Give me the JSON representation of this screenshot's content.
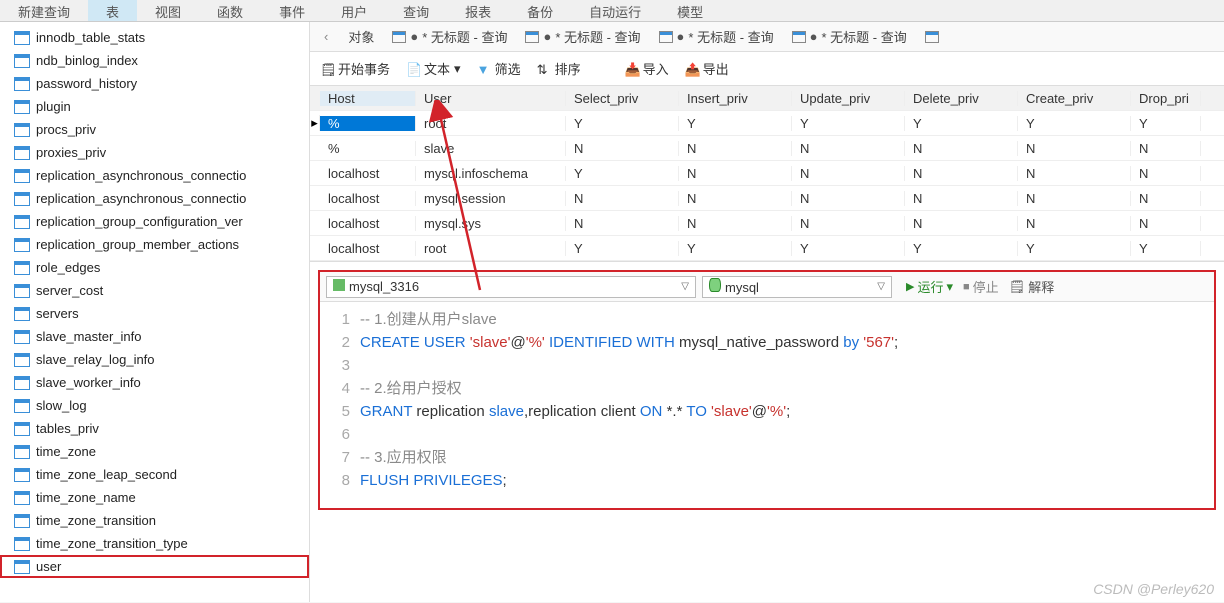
{
  "topmenu": {
    "items": [
      "新建查询",
      "表",
      "视图",
      "函数",
      "事件",
      "用户",
      "查询",
      "报表",
      "备份",
      "自动运行",
      "模型"
    ],
    "active_index": 1
  },
  "sidebar": {
    "items": [
      "innodb_table_stats",
      "ndb_binlog_index",
      "password_history",
      "plugin",
      "procs_priv",
      "proxies_priv",
      "replication_asynchronous_connectio",
      "replication_asynchronous_connectio",
      "replication_group_configuration_ver",
      "replication_group_member_actions",
      "role_edges",
      "server_cost",
      "servers",
      "slave_master_info",
      "slave_relay_log_info",
      "slave_worker_info",
      "slow_log",
      "tables_priv",
      "time_zone",
      "time_zone_leap_second",
      "time_zone_name",
      "time_zone_transition",
      "time_zone_transition_type",
      "user"
    ],
    "selected_index": 23
  },
  "tabs": {
    "object_label": "对象",
    "items": [
      {
        "dot": "●",
        "label": "* 无标题 - 查询"
      },
      {
        "dot": "●",
        "label": "* 无标题 - 查询"
      },
      {
        "dot": "●",
        "label": "* 无标题 - 查询"
      },
      {
        "dot": "●",
        "label": "* 无标题 - 查询"
      }
    ]
  },
  "toolbar": {
    "begin_tx": "开始事务",
    "text": "文本",
    "filter": "筛选",
    "sort": "排序",
    "import": "导入",
    "export": "导出"
  },
  "grid": {
    "columns": [
      "Host",
      "User",
      "Select_priv",
      "Insert_priv",
      "Update_priv",
      "Delete_priv",
      "Create_priv",
      "Drop_pri"
    ],
    "rows": [
      {
        "marker": "▸",
        "cells": [
          "%",
          "root",
          "Y",
          "Y",
          "Y",
          "Y",
          "Y",
          "Y"
        ],
        "selected": true
      },
      {
        "marker": "",
        "cells": [
          "%",
          "slave",
          "N",
          "N",
          "N",
          "N",
          "N",
          "N"
        ]
      },
      {
        "marker": "",
        "cells": [
          "localhost",
          "mysql.infoschema",
          "Y",
          "N",
          "N",
          "N",
          "N",
          "N"
        ]
      },
      {
        "marker": "",
        "cells": [
          "localhost",
          "mysql.session",
          "N",
          "N",
          "N",
          "N",
          "N",
          "N"
        ]
      },
      {
        "marker": "",
        "cells": [
          "localhost",
          "mysql.sys",
          "N",
          "N",
          "N",
          "N",
          "N",
          "N"
        ]
      },
      {
        "marker": "",
        "cells": [
          "localhost",
          "root",
          "Y",
          "Y",
          "Y",
          "Y",
          "Y",
          "Y"
        ]
      }
    ]
  },
  "query": {
    "connection": "mysql_3316",
    "database": "mysql",
    "buttons": {
      "run": "运行",
      "stop": "停止",
      "explain": "解释"
    },
    "lines": [
      {
        "n": 1,
        "html": "<span class='com'>-- 1.创建从用户slave</span>"
      },
      {
        "n": 2,
        "html": "<span class='kw'>CREATE USER</span> <span class='str'>'slave'</span><span class='pun'>@</span><span class='str'>'%'</span> <span class='kw'>IDENTIFIED WITH</span> mysql_native_password <span class='aft'>by</span> <span class='str'>'567'</span><span class='pun'>;</span>"
      },
      {
        "n": 3,
        "html": ""
      },
      {
        "n": 4,
        "html": "<span class='com'>-- 2.给用户授权</span>"
      },
      {
        "n": 5,
        "html": "<span class='kw'>GRANT</span> replication <span class='aft'>slave</span><span class='pun'>,</span>replication client <span class='kw'>ON</span> <span class='pun'>*.*</span> <span class='kw'>TO</span> <span class='str'>'slave'</span><span class='pun'>@</span><span class='str'>'%'</span><span class='pun'>;</span>"
      },
      {
        "n": 6,
        "html": ""
      },
      {
        "n": 7,
        "html": "<span class='com'>-- 3.应用权限</span>"
      },
      {
        "n": 8,
        "html": "<span class='kw'>FLUSH PRIVILEGES</span><span class='pun'>;</span>"
      }
    ]
  },
  "watermark": "CSDN @Perley620"
}
